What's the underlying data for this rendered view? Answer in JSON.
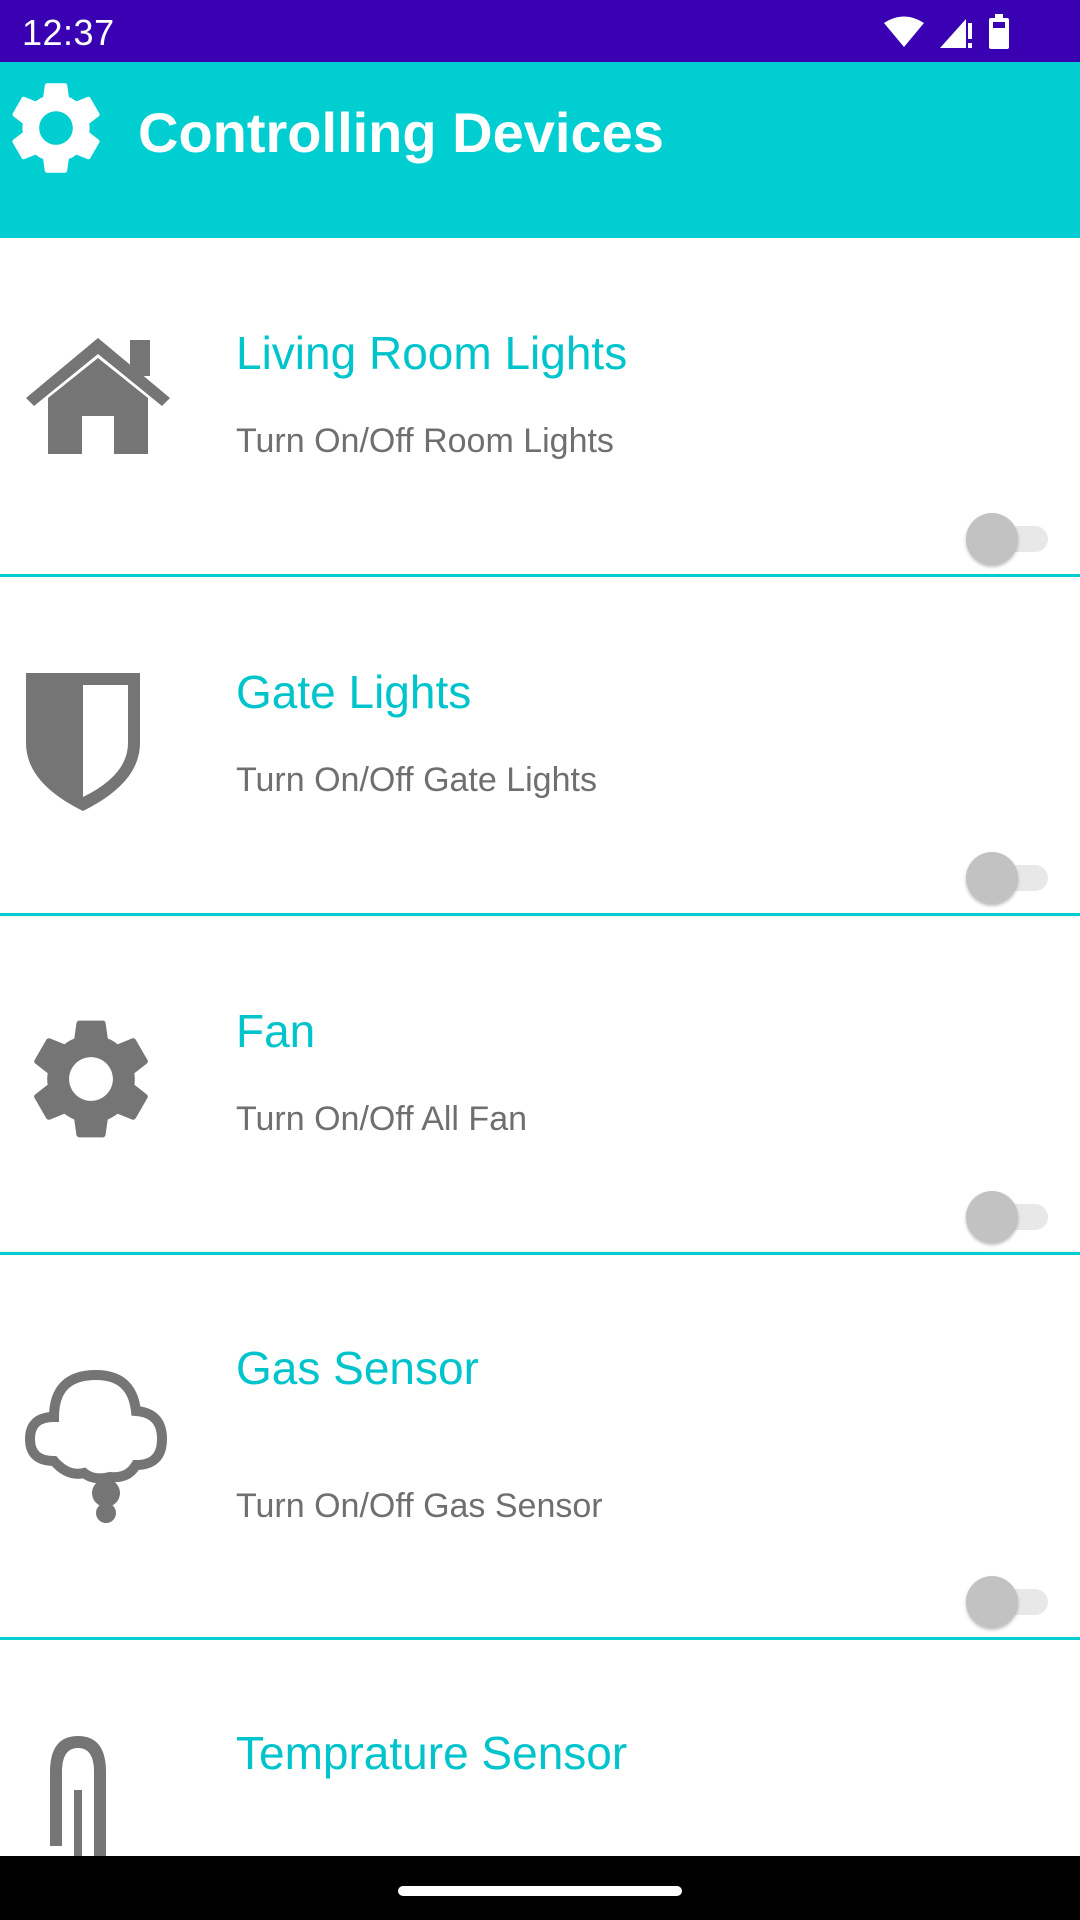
{
  "status_bar": {
    "time": "12:37",
    "icons": [
      "wifi-icon",
      "signal-icon",
      "battery-icon"
    ]
  },
  "app_bar": {
    "icon": "gear-icon",
    "title": "Controlling Devices"
  },
  "colors": {
    "status_bar": "#3a01b2",
    "accent": "#00ced1",
    "title_text": "#00c4cc",
    "subtitle_text": "#6f6f6f",
    "icon": "#757575"
  },
  "devices": [
    {
      "icon": "home-icon",
      "title": "Living Room Lights",
      "subtitle": "Turn On/Off Room Lights",
      "switch_on": false
    },
    {
      "icon": "shield-icon",
      "title": "Gate Lights",
      "subtitle": "Turn On/Off Gate Lights",
      "switch_on": false
    },
    {
      "icon": "gear-icon",
      "title": "Fan",
      "subtitle": "Turn On/Off All Fan",
      "switch_on": false
    },
    {
      "icon": "cloud-icon",
      "title": "Gas Sensor",
      "subtitle": "Turn On/Off Gas Sensor",
      "switch_on": false
    },
    {
      "icon": "thermometer-icon",
      "title": "Temprature Sensor",
      "subtitle": ""
    }
  ]
}
